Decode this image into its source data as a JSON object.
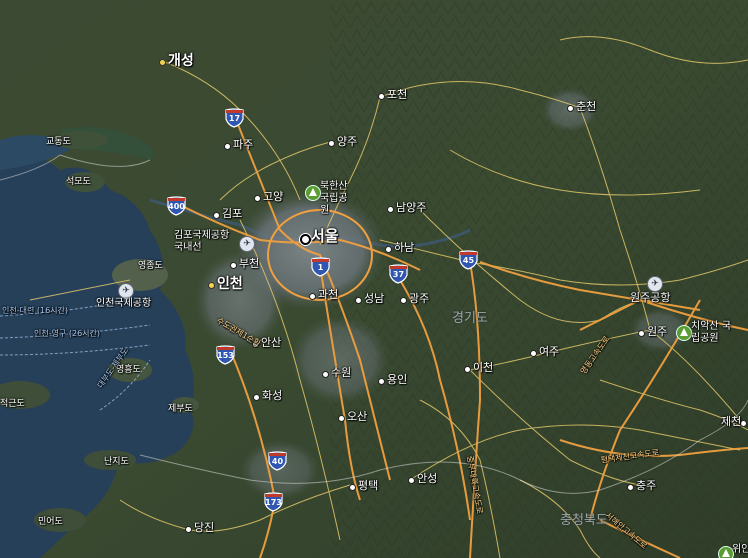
{
  "map": {
    "capital": "서울",
    "cities": [
      "개성",
      "포천",
      "춘천",
      "파주",
      "양주",
      "고양",
      "김포",
      "남양주",
      "하남",
      "부천",
      "인천",
      "과천",
      "성남",
      "광주",
      "안산",
      "여주",
      "이천",
      "원주",
      "수원",
      "용인",
      "화성",
      "오산",
      "평택",
      "안성",
      "충주",
      "당진",
      "제천",
      "원주공항"
    ],
    "islands": [
      "교동도",
      "석모도",
      "영종도",
      "영흥도",
      "제부도",
      "난지도",
      "민어도",
      "적근도"
    ],
    "provinces": [
      "경기도",
      "충청북도"
    ],
    "parks": [
      "북한산 국립공원",
      "치악산 국립공원"
    ],
    "airports": [
      "김포국제공항 국내선",
      "인천국제공항",
      "원주공항"
    ],
    "ferries": [
      "인천-대련 (16시간)",
      "인천-영구 (26시간)",
      "대부도-제부도"
    ],
    "routes": [
      "17",
      "400",
      "1",
      "37",
      "45",
      "153",
      "40",
      "173"
    ],
    "expressways": [
      "수도권제1순환",
      "중부내륙고속도로",
      "영동고속도로",
      "서해안고속도로",
      "평택제천고속도로"
    ],
    "overflow": [
      "위안시"
    ],
    "colors": {
      "land": "#3a4b30",
      "water": "#25405b",
      "urban": "#7c8590",
      "road_major": "#f0a040",
      "road_minor": "#e3c86a",
      "shield_blue": "#2f56b0",
      "shield_red": "#c0392b"
    }
  }
}
